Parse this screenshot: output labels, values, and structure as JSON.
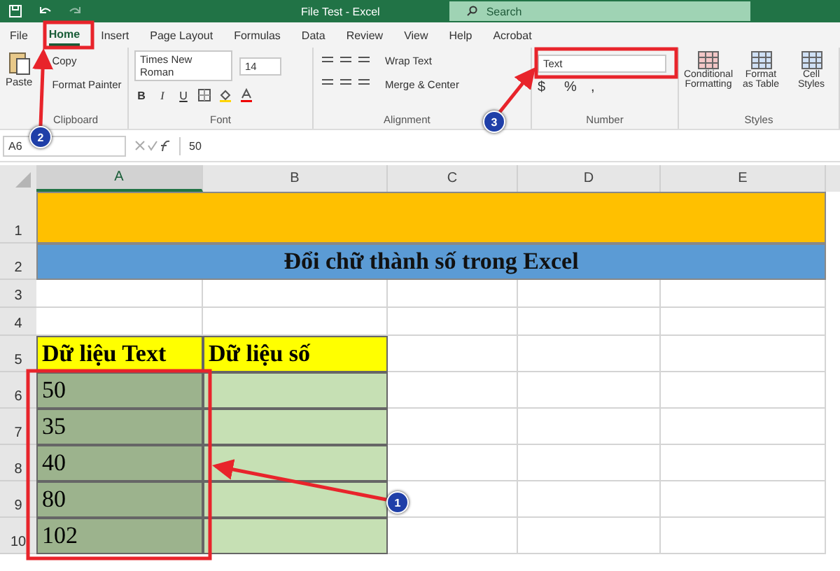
{
  "window": {
    "title": "File Test  -  Excel",
    "search_placeholder": "Search"
  },
  "tabs": [
    {
      "label": "File",
      "selected": false
    },
    {
      "label": "Home",
      "selected": true
    },
    {
      "label": "Insert",
      "selected": false
    },
    {
      "label": "Page Layout",
      "selected": false
    },
    {
      "label": "Formulas",
      "selected": false
    },
    {
      "label": "Data",
      "selected": false
    },
    {
      "label": "Review",
      "selected": false
    },
    {
      "label": "View",
      "selected": false
    },
    {
      "label": "Help",
      "selected": false
    },
    {
      "label": "Acrobat",
      "selected": false
    }
  ],
  "ribbon": {
    "clipboard": {
      "label": "Clipboard",
      "paste": "Paste",
      "copy": "Copy",
      "format_painter": "Format Painter"
    },
    "font": {
      "label": "Font",
      "name": "Times New Roman",
      "size": "14",
      "styles": [
        "B",
        "I",
        "U"
      ]
    },
    "alignment": {
      "label": "Alignment",
      "wrap_text": "Wrap Text",
      "merge": "Merge & Center"
    },
    "number": {
      "label": "Number",
      "format": "Text",
      "buttons": [
        "$",
        "%",
        ","
      ]
    },
    "styles": {
      "label": "Styles",
      "buttons": [
        "Conditional Formatting",
        "Format as Table",
        "Cell Styles"
      ]
    }
  },
  "formula_bar": {
    "name_box": "A6",
    "value": "50"
  },
  "columns": [
    {
      "label": "A",
      "selected": true
    },
    {
      "label": "B",
      "selected": false
    },
    {
      "label": "C",
      "selected": false
    },
    {
      "label": "D",
      "selected": false
    },
    {
      "label": "E",
      "selected": false
    }
  ],
  "rows": [
    {
      "header": "1",
      "kind": "banner"
    },
    {
      "header": "2",
      "kind": "title",
      "text": "Đổi chữ thành số trong Excel"
    },
    {
      "header": "3",
      "kind": "blank"
    },
    {
      "header": "4",
      "kind": "blank"
    },
    {
      "header": "5",
      "kind": "header",
      "cells": [
        "Dữ liệu Text",
        "Dữ liệu số"
      ]
    },
    {
      "header": "6",
      "kind": "data",
      "value": "50",
      "selected": true
    },
    {
      "header": "7",
      "kind": "data",
      "value": "35",
      "selected": true
    },
    {
      "header": "8",
      "kind": "data",
      "value": "40",
      "selected": true
    },
    {
      "header": "9",
      "kind": "data",
      "value": "80",
      "selected": true
    },
    {
      "header": "10",
      "kind": "data",
      "value": "102",
      "selected": true
    }
  ],
  "annotations": [
    {
      "marker": "2"
    },
    {
      "marker": "3"
    },
    {
      "marker": "1"
    }
  ]
}
